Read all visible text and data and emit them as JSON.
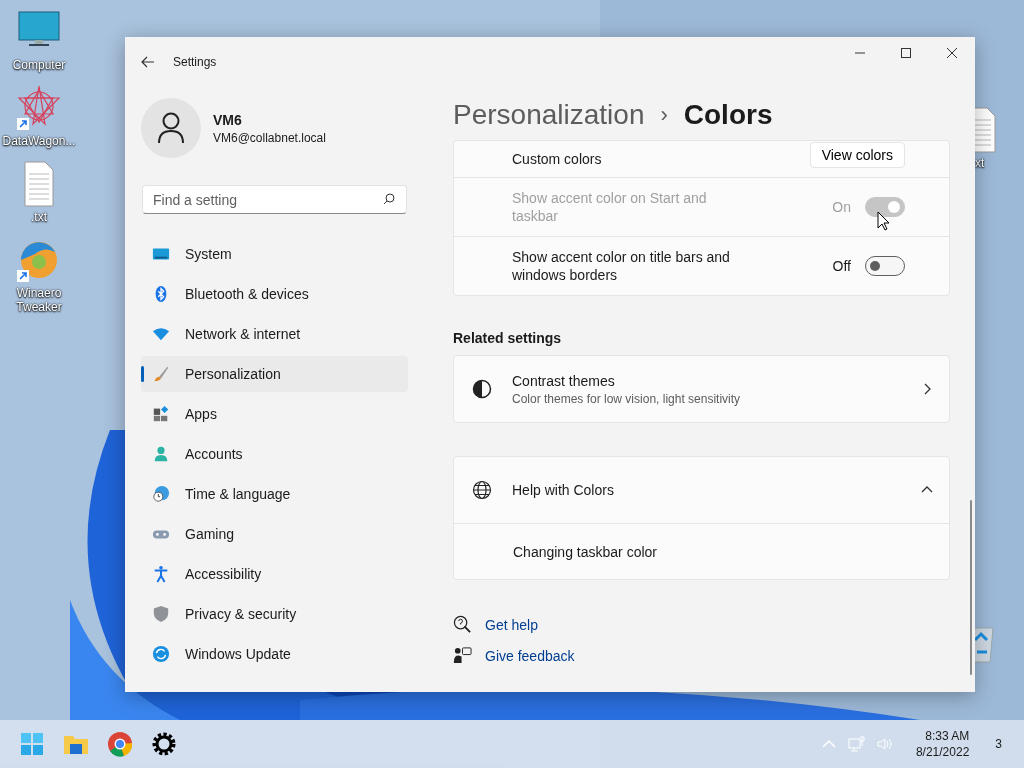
{
  "desktop": {
    "icons": [
      {
        "label": "Computer",
        "kind": "monitor",
        "shortcut": false
      },
      {
        "label": "DataWagon...",
        "kind": "star",
        "shortcut": true
      },
      {
        "label": ".txt",
        "kind": "text-file",
        "shortcut": false
      },
      {
        "label": "Winaero Tweaker",
        "kind": "swirl",
        "shortcut": true
      }
    ],
    "right_icons": [
      {
        "label": "xt",
        "kind": "text-file"
      },
      {
        "kind": "recycle-bin"
      }
    ]
  },
  "window": {
    "title": "Settings",
    "user": {
      "name": "VM6",
      "email": "VM6@collabnet.local"
    },
    "search": {
      "placeholder": "Find a setting"
    },
    "nav": [
      {
        "label": "System",
        "kind": "system",
        "selected": false
      },
      {
        "label": "Bluetooth & devices",
        "kind": "bluetooth",
        "selected": false
      },
      {
        "label": "Network & internet",
        "kind": "network",
        "selected": false
      },
      {
        "label": "Personalization",
        "kind": "personalization",
        "selected": true
      },
      {
        "label": "Apps",
        "kind": "apps",
        "selected": false
      },
      {
        "label": "Accounts",
        "kind": "accounts",
        "selected": false
      },
      {
        "label": "Time & language",
        "kind": "time",
        "selected": false
      },
      {
        "label": "Gaming",
        "kind": "gaming",
        "selected": false
      },
      {
        "label": "Accessibility",
        "kind": "accessibility",
        "selected": false
      },
      {
        "label": "Privacy & security",
        "kind": "privacy",
        "selected": false
      },
      {
        "label": "Windows Update",
        "kind": "update",
        "selected": false
      }
    ],
    "breadcrumb": {
      "parent": "Personalization",
      "separator": "›",
      "current": "Colors"
    },
    "settings": [
      {
        "kind": "button",
        "label": "Custom colors",
        "button": "View colors"
      },
      {
        "kind": "toggle",
        "label": "Show accent color on Start and taskbar",
        "state_text": "On",
        "on": true,
        "disabled": true
      },
      {
        "kind": "toggle",
        "label": "Show accent color on title bars and windows borders",
        "state_text": "Off",
        "on": false,
        "disabled": false
      }
    ],
    "related": {
      "title": "Related settings",
      "items": [
        {
          "title": "Contrast themes",
          "description": "Color themes for low vision, light sensitivity"
        }
      ]
    },
    "help": {
      "title": "Help with Colors",
      "expanded": true,
      "links": [
        "Changing taskbar color"
      ]
    },
    "footer_links": [
      {
        "label": "Get help",
        "kind": "help"
      },
      {
        "label": "Give feedback",
        "kind": "feedback"
      }
    ]
  },
  "taskbar": {
    "apps": [
      {
        "kind": "start"
      },
      {
        "kind": "explorer"
      },
      {
        "kind": "chrome"
      },
      {
        "kind": "settings"
      }
    ],
    "time": "8:33 AM",
    "date": "8/21/2022",
    "notifications": "3"
  }
}
